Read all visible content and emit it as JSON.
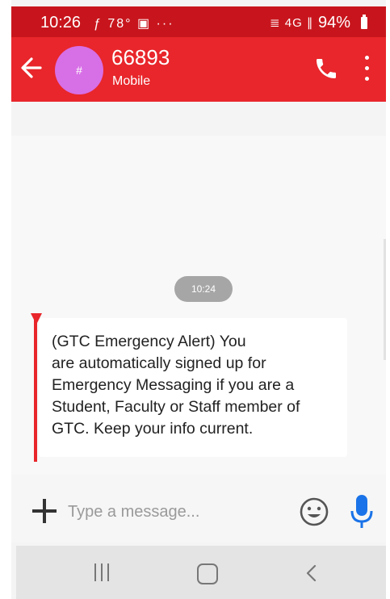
{
  "status_bar": {
    "time": "10:26",
    "left_icons": "ƒ 78° ▣ ···",
    "right_icons": "≣ 4G ∥",
    "battery": "94%"
  },
  "header": {
    "avatar_label": "#",
    "contact_name": "66893",
    "contact_subtitle": "Mobile",
    "accent_color": "#e8262b",
    "status_color": "#c8151d"
  },
  "conversation": {
    "timestamp": "10:24",
    "message_lines": [
      "(GTC Emergency Alert) You",
      "are automatically signed up for",
      "Emergency Messaging if you are a",
      "Student, Faculty or Staff member of",
      "GTC. Keep your info current."
    ]
  },
  "composer": {
    "placeholder": "Type a message...",
    "value": ""
  },
  "icons": {
    "back": "arrow-left",
    "call": "phone",
    "more": "vertical-dots",
    "attach": "plus",
    "emoji": "smiley",
    "voice": "microphone",
    "nav_recents": "three-bars",
    "nav_home": "rounded-square",
    "nav_back": "chevron-left"
  }
}
